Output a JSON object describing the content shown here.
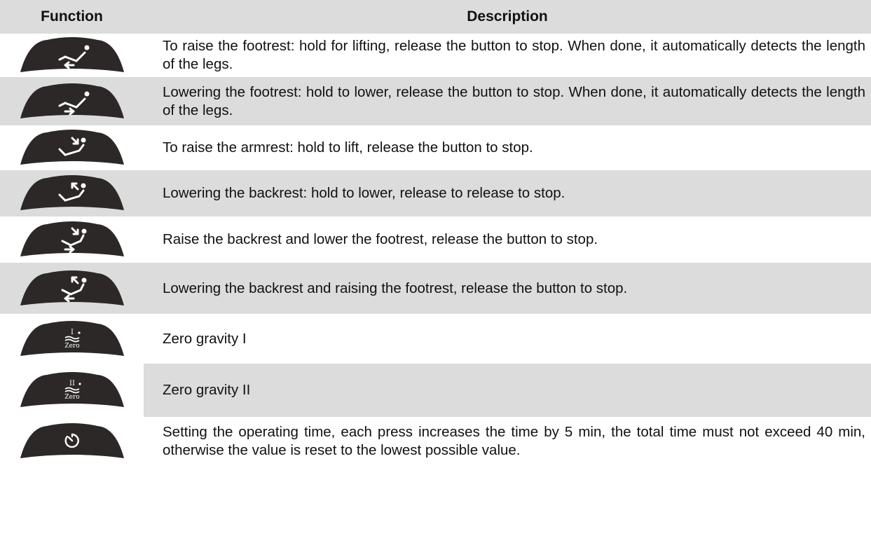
{
  "header": {
    "function": "Function",
    "description": "Description"
  },
  "rows": [
    {
      "icon": "chair-footrest-up-icon",
      "description": "To raise the footrest: hold for lifting, release the button to stop. When done, it automatically detects the length of the legs."
    },
    {
      "icon": "chair-footrest-down-icon",
      "description": "Lowering the footrest: hold to lower, release the button to stop. When done, it automatically detects the length of the legs."
    },
    {
      "icon": "chair-backrest-up-icon",
      "description": "To raise the armrest: hold to lift, release the button to stop."
    },
    {
      "icon": "chair-backrest-down-icon",
      "description": "Lowering the backrest: hold to lower, release to release to stop."
    },
    {
      "icon": "chair-back-up-foot-down-icon",
      "description": "Raise the backrest and lower the footrest, release the button to stop."
    },
    {
      "icon": "chair-back-down-foot-up-icon",
      "description": "Lowering the backrest and raising the footrest, release the button to stop."
    },
    {
      "icon": "zero-gravity-1-icon",
      "icon_label": "Zero",
      "icon_numeral": "I",
      "description": "Zero gravity I"
    },
    {
      "icon": "zero-gravity-2-icon",
      "icon_label": "Zero",
      "icon_numeral": "II",
      "description": "Zero gravity II"
    },
    {
      "icon": "timer-icon",
      "description": "Setting the operating time, each press increases the time by 5 min, the total time must not exceed 40 min, otherwise the value is reset to the lowest possible value."
    }
  ],
  "colors": {
    "key": "#2b2827",
    "row_shade": "#dcdcdc"
  }
}
